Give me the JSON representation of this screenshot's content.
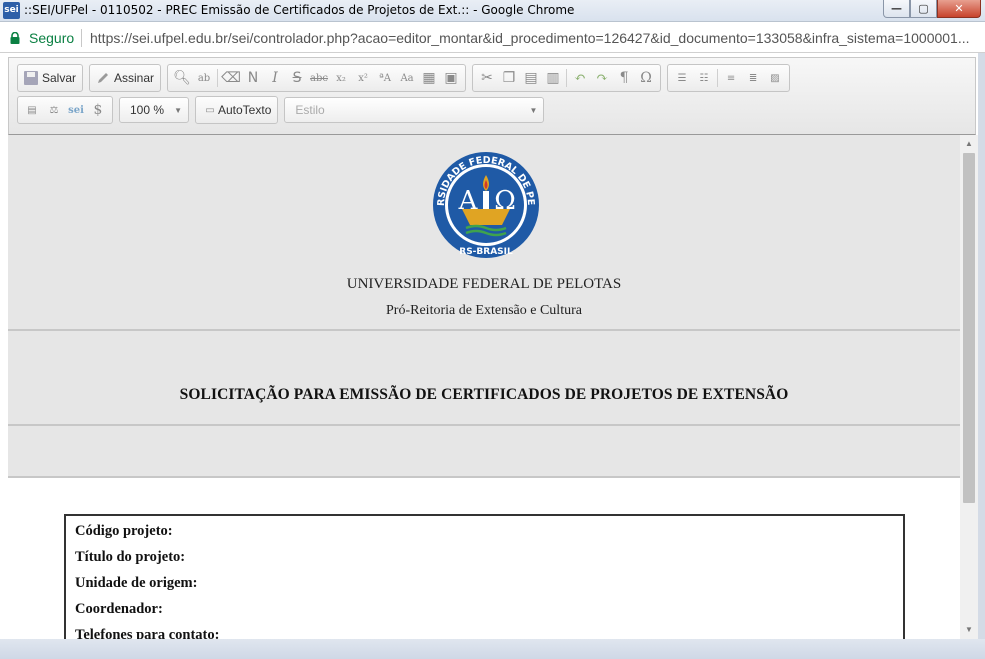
{
  "window": {
    "logo_text": "sei",
    "title": "::SEI/UFPel - 0110502 - PREC Emissão de Certificados de Projetos de Ext.:: - Google Chrome",
    "buttons": {
      "minimize": "—",
      "maximize": "▢",
      "close": "✕"
    }
  },
  "address_bar": {
    "secure_label": "Seguro",
    "url": "https://sei.ufpel.edu.br/sei/controlador.php?acao=editor_montar&id_procedimento=126427&id_documento=133058&infra_sistema=1000001..."
  },
  "toolbar": {
    "save_label": "Salvar",
    "sign_label": "Assinar",
    "format_icons": [
      "N",
      "I",
      "S",
      "abc",
      "x₂",
      "x²"
    ],
    "zoom_value": "100 %",
    "autotext_label": "AutoTexto",
    "style_placeholder": "Estilo"
  },
  "document": {
    "emblem": {
      "ring_text": "UNIVERSIDADE FEDERAL DE PELOTAS",
      "bottom_text": "RS-BRASIL",
      "alpha": "A",
      "omega": "Ω"
    },
    "university": "UNIVERSIDADE FEDERAL DE PELOTAS",
    "department": "Pró-Reitoria de Extensão e Cultura",
    "title": "SOLICITAÇÃO PARA EMISSÃO DE CERTIFICADOS DE PROJETOS DE EXTENSÃO",
    "fields": [
      "Código projeto:",
      "Título do projeto:",
      "Unidade de origem:",
      "Coordenador:",
      "Telefones para contato:"
    ]
  },
  "colors": {
    "secure_green": "#0b8043",
    "emblem_blue": "#1f5aa6",
    "emblem_gold": "#e0a423",
    "header_gray": "#e6e6e6"
  }
}
